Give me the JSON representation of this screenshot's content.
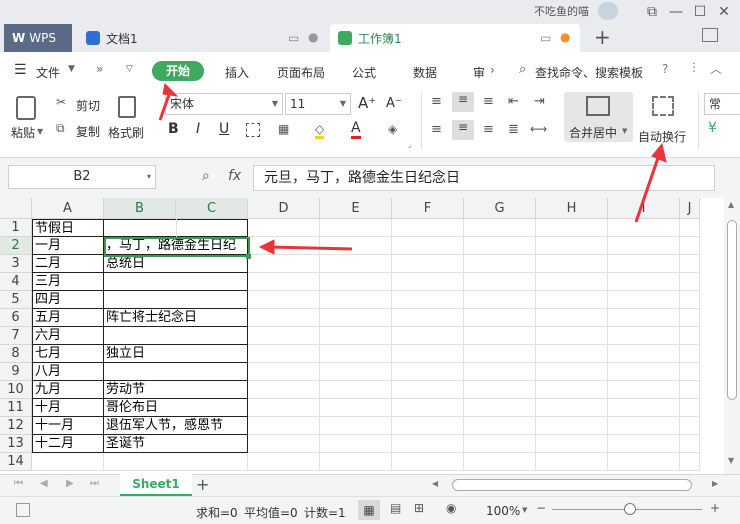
{
  "titlebar": {
    "user": "不吃鱼的喵",
    "tabs": [
      {
        "label": "WPS"
      },
      {
        "label": "文档1"
      },
      {
        "label": "工作簿1"
      }
    ],
    "new_tab": "+"
  },
  "menu": {
    "file": "文件",
    "items": [
      "开始",
      "插入",
      "页面布局",
      "公式",
      "数据",
      "审"
    ],
    "search": "查找命令、搜索模板"
  },
  "ribbon": {
    "paste": "粘贴",
    "cut": "剪切",
    "copy": "复制",
    "format_painter": "格式刷",
    "font_name": "宋体",
    "font_size": "11",
    "bold": "B",
    "italic": "I",
    "underline": "U",
    "merge_center": "合并居中",
    "wrap_text": "自动换行",
    "number_format": "常"
  },
  "formula_bar": {
    "name_box": "B2",
    "fx": "fx",
    "content": "元旦，马丁，路德金生日纪念日"
  },
  "sheet": {
    "columns": [
      "A",
      "B",
      "C",
      "D",
      "E",
      "F",
      "G",
      "H",
      "I",
      "J"
    ],
    "rows": [
      {
        "num": "1",
        "a": "节假日",
        "b": ""
      },
      {
        "num": "2",
        "a": "一月",
        "b": "，马丁，路德金生日纪"
      },
      {
        "num": "3",
        "a": "二月",
        "b": "总统日"
      },
      {
        "num": "4",
        "a": "三月",
        "b": ""
      },
      {
        "num": "5",
        "a": "四月",
        "b": ""
      },
      {
        "num": "6",
        "a": "五月",
        "b": "阵亡将士纪念日"
      },
      {
        "num": "7",
        "a": "六月",
        "b": ""
      },
      {
        "num": "8",
        "a": "七月",
        "b": "独立日"
      },
      {
        "num": "9",
        "a": "八月",
        "b": ""
      },
      {
        "num": "10",
        "a": "九月",
        "b": "劳动节"
      },
      {
        "num": "11",
        "a": "十月",
        "b": "哥伦布日"
      },
      {
        "num": "12",
        "a": "十一月",
        "b": "退伍军人节，感恩节"
      },
      {
        "num": "13",
        "a": "十二月",
        "b": "圣诞节"
      },
      {
        "num": "14",
        "a": "",
        "b": ""
      }
    ],
    "sheet_tab": "Sheet1"
  },
  "status": {
    "sum": "求和=0",
    "avg": "平均值=0",
    "count": "计数=1",
    "zoom": "100%"
  },
  "colors": {
    "accent": "#3eaa5f",
    "arrow": "#e8353a",
    "wps_tab": "#5b6a86"
  }
}
